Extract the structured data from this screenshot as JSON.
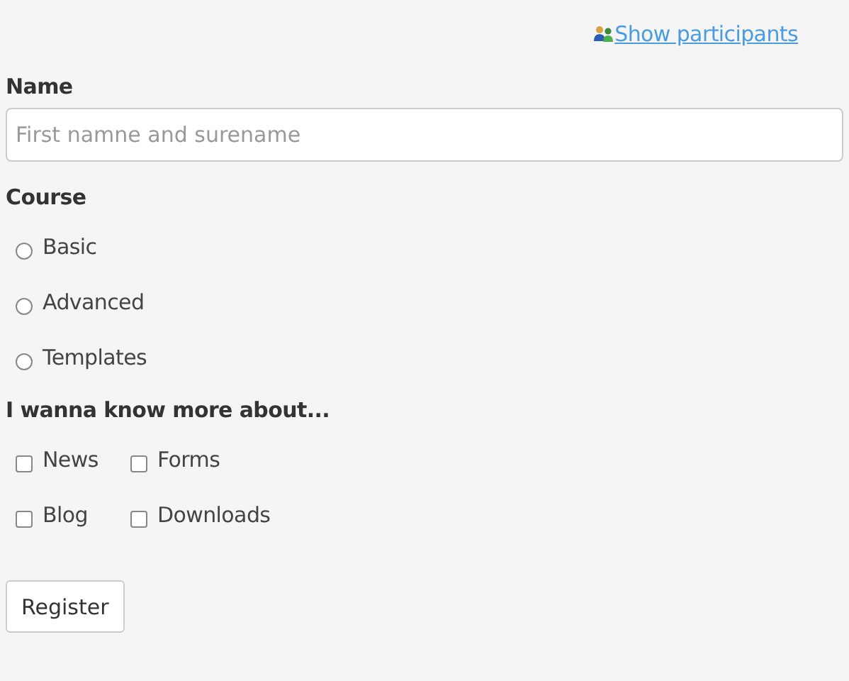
{
  "header_link": {
    "label": "Show participants"
  },
  "name_field": {
    "label": "Name",
    "placeholder": "First namne and surename"
  },
  "course": {
    "label": "Course",
    "options": [
      {
        "label": "Basic",
        "selected": false
      },
      {
        "label": "Advanced",
        "selected": false
      },
      {
        "label": "Templates",
        "selected": false
      }
    ]
  },
  "interests": {
    "label": "I wanna know more about...",
    "options": [
      {
        "label": "News",
        "checked": false
      },
      {
        "label": "Forms",
        "checked": false
      },
      {
        "label": "Blog",
        "checked": false
      },
      {
        "label": "Downloads",
        "checked": false
      }
    ]
  },
  "submit_button": {
    "label": "Register"
  }
}
